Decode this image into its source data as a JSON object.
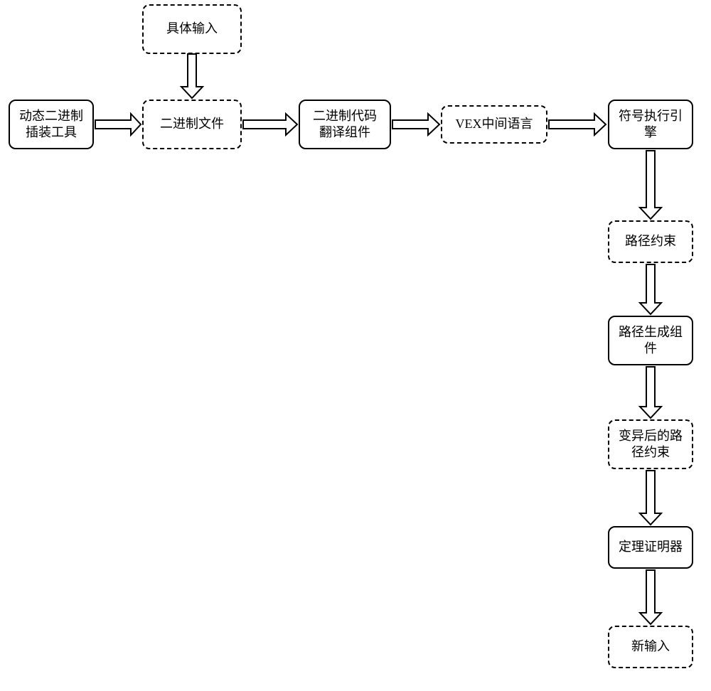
{
  "nodes": {
    "concreteInput": {
      "label": "具体输入"
    },
    "instrTool": {
      "label": "动态二进制插装工具"
    },
    "binaryFile": {
      "label": "二进制文件"
    },
    "transComp": {
      "label": "二进制代码翻译组件"
    },
    "vexIR": {
      "label": "VEX中间语言"
    },
    "symEngine": {
      "label": "符号执行引擎"
    },
    "pathConstr": {
      "label": "路径约束"
    },
    "pathGen": {
      "label": "路径生成组件"
    },
    "mutConstr": {
      "label": "变异后的路径约束"
    },
    "prover": {
      "label": "定理证明器"
    },
    "newInput": {
      "label": "新输入"
    }
  }
}
